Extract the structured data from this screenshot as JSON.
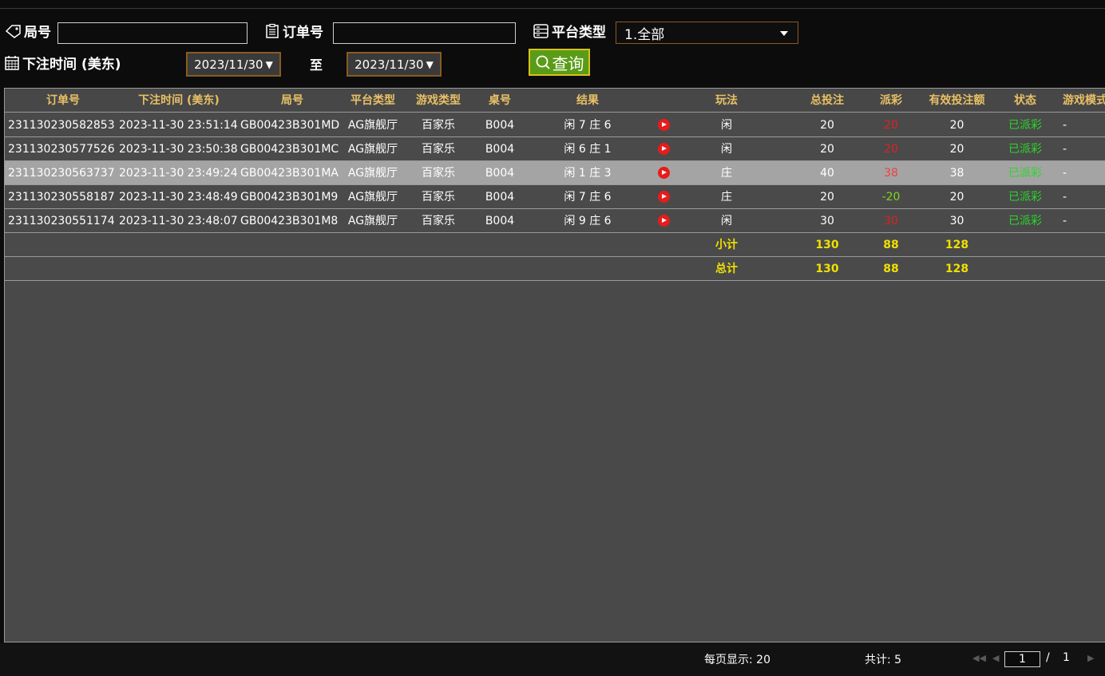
{
  "filters": {
    "game_no_label": "局号",
    "order_no_label": "订单号",
    "platform_label": "平台类型",
    "platform_value": "1.全部",
    "bet_time_label": "下注时间 (美东)",
    "date_from": "2023/11/30",
    "to_label": "至",
    "date_to": "2023/11/30",
    "date_arrow": "▼",
    "search_label": "查询"
  },
  "table": {
    "headers": {
      "order": "订单号",
      "time": "下注时间 (美东)",
      "game": "局号",
      "platform": "平台类型",
      "game_type": "游戏类型",
      "table_no": "桌号",
      "result": "结果",
      "play": "玩法",
      "total_bet": "总投注",
      "payout": "派彩",
      "valid_bet": "有效投注额",
      "status": "状态",
      "mode": "游戏模式"
    },
    "rows": [
      {
        "order": "231130230582853",
        "time": "2023-11-30 23:51:14",
        "game": "GB00423B301MD",
        "platform": "AG旗舰厅",
        "game_type": "百家乐",
        "table_no": "B004",
        "result": "闲 7 庄 6",
        "play": "闲",
        "total_bet": "20",
        "payout": "20",
        "payout_color": "#e02020",
        "valid_bet": "20",
        "status": "已派彩",
        "mode": "-"
      },
      {
        "order": "231130230577526",
        "time": "2023-11-30 23:50:38",
        "game": "GB00423B301MC",
        "platform": "AG旗舰厅",
        "game_type": "百家乐",
        "table_no": "B004",
        "result": "闲 6 庄 1",
        "play": "闲",
        "total_bet": "20",
        "payout": "20",
        "payout_color": "#e02020",
        "valid_bet": "20",
        "status": "已派彩",
        "mode": "-"
      },
      {
        "order": "231130230563737",
        "time": "2023-11-30 23:49:24",
        "game": "GB00423B301MA",
        "platform": "AG旗舰厅",
        "game_type": "百家乐",
        "table_no": "B004",
        "result": "闲 1 庄 3",
        "play": "庄",
        "total_bet": "40",
        "payout": "38",
        "payout_color": "#f04040",
        "valid_bet": "38",
        "status": "已派彩",
        "mode": "-"
      },
      {
        "order": "231130230558187",
        "time": "2023-11-30 23:48:49",
        "game": "GB00423B301M9",
        "platform": "AG旗舰厅",
        "game_type": "百家乐",
        "table_no": "B004",
        "result": "闲 7 庄 6",
        "play": "庄",
        "total_bet": "20",
        "payout": "-20",
        "payout_color": "#7fd61b",
        "valid_bet": "20",
        "status": "已派彩",
        "mode": "-"
      },
      {
        "order": "231130230551174",
        "time": "2023-11-30 23:48:07",
        "game": "GB00423B301M8",
        "platform": "AG旗舰厅",
        "game_type": "百家乐",
        "table_no": "B004",
        "result": "闲 9 庄 6",
        "play": "闲",
        "total_bet": "30",
        "payout": "30",
        "payout_color": "#e02020",
        "valid_bet": "30",
        "status": "已派彩",
        "mode": "-"
      }
    ],
    "highlighted_row": 2,
    "subtotal": {
      "label": "小计",
      "total_bet": "130",
      "payout": "88",
      "valid_bet": "128"
    },
    "total": {
      "label": "总计",
      "total_bet": "130",
      "payout": "88",
      "valid_bet": "128"
    }
  },
  "footer": {
    "per_page": "每页显示: 20",
    "count": "共计: 5",
    "current_page": "1",
    "separator": "/",
    "total_pages": "1"
  },
  "colors": {
    "header_text": "#e8c066",
    "status_green": "#2bd62b",
    "summary_yellow": "#f0e000",
    "search_button": "#5a9c17"
  }
}
